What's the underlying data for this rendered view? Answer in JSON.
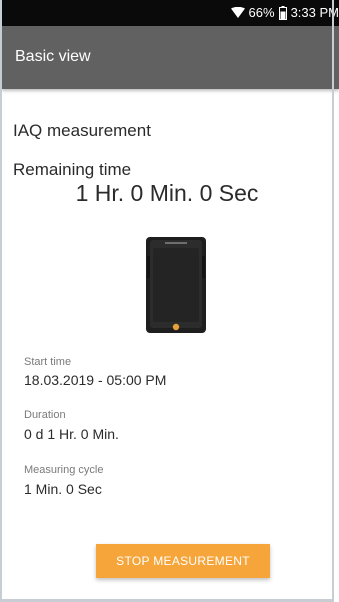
{
  "status_bar": {
    "battery_percent": "66%",
    "time": "3:33 PM",
    "icons": [
      "wifi-icon",
      "battery-icon"
    ]
  },
  "app_bar": {
    "title": "Basic view"
  },
  "measurement": {
    "title": "IAQ measurement",
    "remaining_label": "Remaining time",
    "remaining_value": "1 Hr. 0 Min. 0 Sec"
  },
  "details": {
    "start_time_label": "Start time",
    "start_time_value": "18.03.2019 - 05:00 PM",
    "duration_label": "Duration",
    "duration_value": "0 d 1 Hr. 0 Min.",
    "cycle_label": "Measuring cycle",
    "cycle_value": "1 Min. 0 Sec"
  },
  "actions": {
    "stop_label": "STOP MEASUREMENT"
  },
  "colors": {
    "status_bar": "#0a0a0a",
    "app_bar": "#616161",
    "accent_button": "#f6a53a",
    "device_led": "#e8a13a"
  }
}
